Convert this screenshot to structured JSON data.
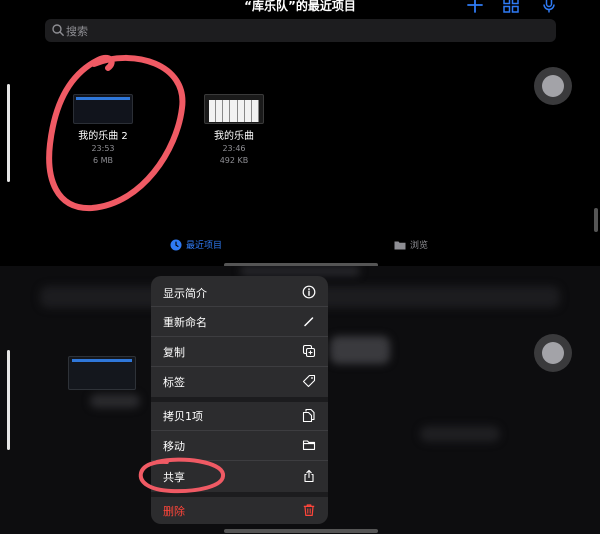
{
  "header": {
    "title": "“库乐队”的最近项目",
    "add_icon": "plus-icon",
    "grid_icon": "grid-icon",
    "mic_icon": "mic-icon"
  },
  "search": {
    "placeholder": "搜索"
  },
  "files": [
    {
      "name": "我的乐曲 2",
      "time": "23:53",
      "size": "6 MB"
    },
    {
      "name": "我的乐曲",
      "time": "23:46",
      "size": "492 KB"
    }
  ],
  "tabs": [
    {
      "label": "最近项目",
      "icon": "clock-icon",
      "active": true
    },
    {
      "label": "浏览",
      "icon": "folder-icon",
      "active": false
    }
  ],
  "context_menu": {
    "items": [
      {
        "label": "显示简介",
        "icon": "info-icon"
      },
      {
        "label": "重新命名",
        "icon": "pencil-icon"
      },
      {
        "label": "复制",
        "icon": "duplicate-icon"
      },
      {
        "label": "标签",
        "icon": "tag-icon"
      },
      {
        "label": "拷贝1项",
        "icon": "copy-doc-icon"
      },
      {
        "label": "移动",
        "icon": "folder-icon"
      },
      {
        "label": "共享",
        "icon": "share-icon"
      },
      {
        "label": "删除",
        "icon": "trash-icon"
      }
    ]
  },
  "colors": {
    "accent": "#2f7bf5",
    "annotation": "#f05a64",
    "danger": "#ff453a",
    "menu_bg": "#2c2c2e"
  }
}
